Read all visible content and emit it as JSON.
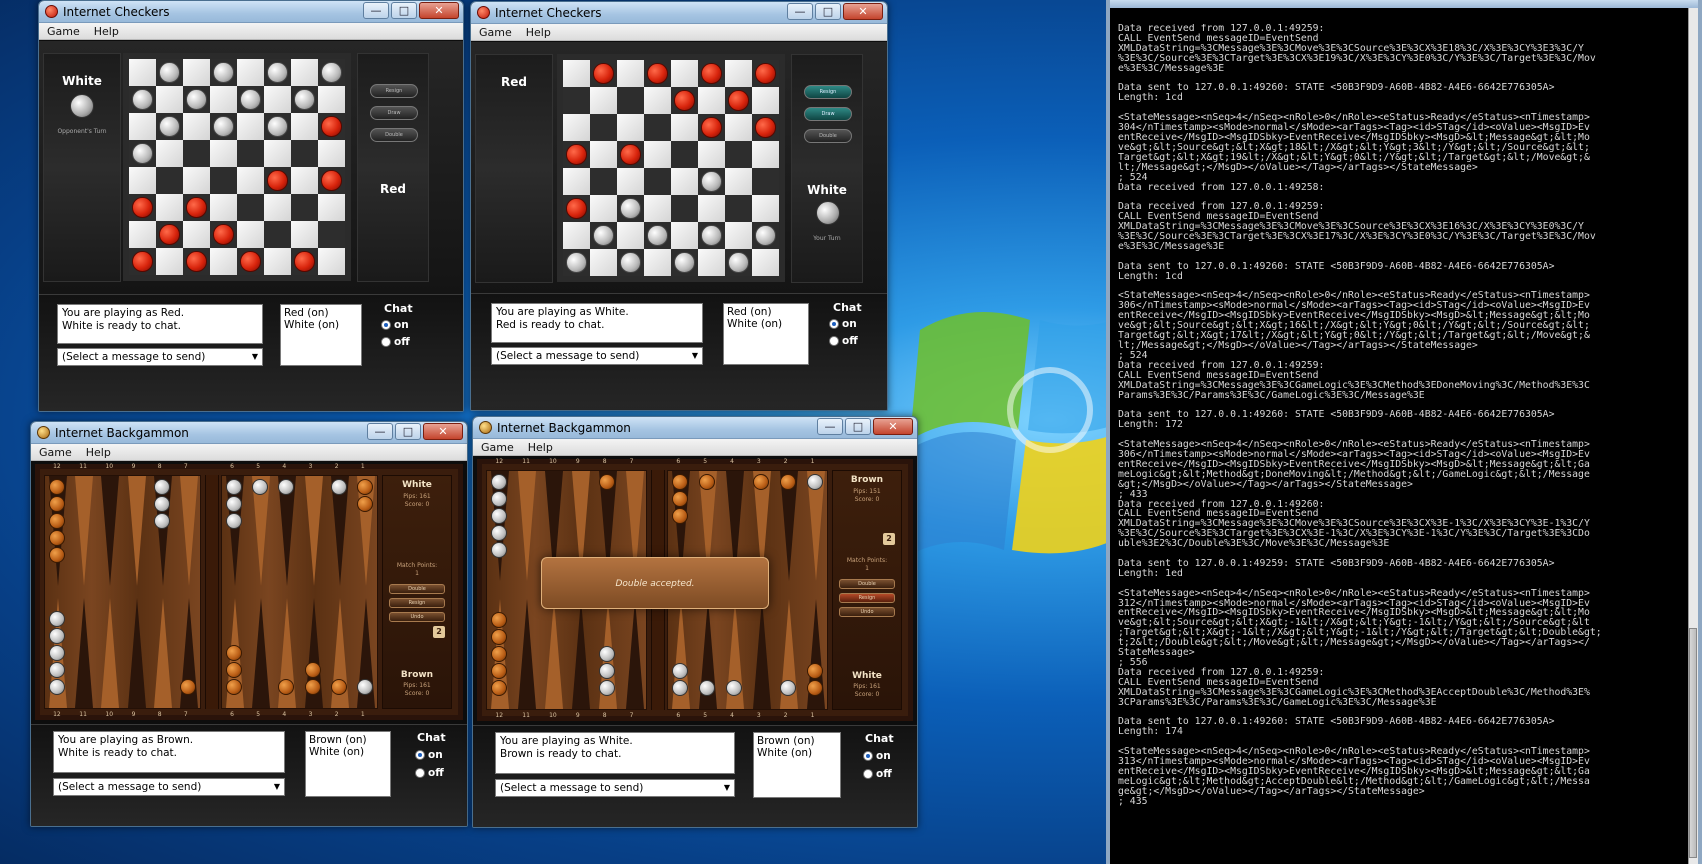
{
  "checkers1": {
    "title": "Internet Checkers",
    "menu": [
      "Game",
      "Help"
    ],
    "left_player": "White",
    "left_status": "Opponent's Turn",
    "right_player": "Red",
    "side_buttons": [
      "Resign",
      "Draw",
      "Double"
    ],
    "messages": [
      "You are playing as Red.",
      "White is ready to chat."
    ],
    "select": "(Select a message to send)",
    "players": [
      "Red (on)",
      "White (on)"
    ],
    "chat_label": "Chat",
    "radio_on": "on",
    "radio_off": "off",
    "board": [
      "-w-w-w-w",
      "w-w-w-w-",
      "-w-w-w-r",
      "w-------",
      "-----r-r",
      "r-r-----",
      "-r-r----",
      "r-r-r-r-"
    ]
  },
  "checkers2": {
    "title": "Internet Checkers",
    "menu": [
      "Game",
      "Help"
    ],
    "left_player": "Red",
    "right_player": "White",
    "right_status": "Your Turn",
    "side_buttons": [
      "Resign",
      "Draw",
      "Double"
    ],
    "messages": [
      "You are playing as White.",
      "Red is ready to chat."
    ],
    "select": "(Select a message to send)",
    "players": [
      "Red (on)",
      "White (on)"
    ],
    "chat_label": "Chat",
    "radio_on": "on",
    "radio_off": "off",
    "board": [
      "-r-r-r-r",
      "----r-r-",
      "-----r-r",
      "r-r-----",
      "-----w--",
      "r-w-----",
      "-w-w-w-w",
      "w-w-w-w-"
    ]
  },
  "backgammon1": {
    "title": "Internet Backgammon",
    "menu": [
      "Game",
      "Help"
    ],
    "top_player": "White",
    "top_pips": "Pips: 161",
    "top_score": "Score: 0",
    "match_points": "Match Points:",
    "match_value": "1",
    "buttons": [
      "Double",
      "Resign",
      "Undo"
    ],
    "cube": "2",
    "bottom_player": "Brown",
    "bottom_pips": "Pips: 161",
    "bottom_score": "Score: 0",
    "top_numbers": [
      "12",
      "11",
      "10",
      "9",
      "8",
      "7",
      "6",
      "5",
      "4",
      "3",
      "2",
      "1"
    ],
    "bottom_numbers": [
      "12",
      "11",
      "10",
      "9",
      "8",
      "7",
      "6",
      "5",
      "4",
      "3",
      "2",
      "1"
    ],
    "messages": [
      "You are playing as Brown.",
      "White is ready to chat."
    ],
    "select": "(Select a message to send)",
    "players": [
      "Brown (on)",
      "White (on)"
    ],
    "chat_label": "Chat",
    "radio_on": "on",
    "radio_off": "off"
  },
  "backgammon2": {
    "title": "Internet Backgammon",
    "menu": [
      "Game",
      "Help"
    ],
    "top_player": "Brown",
    "top_pips": "Pips: 151",
    "top_score": "Score: 0",
    "match_points": "Match Points:",
    "match_value": "1",
    "buttons": [
      "Double",
      "Resign",
      "Undo"
    ],
    "cube": "2",
    "bottom_player": "White",
    "bottom_pips": "Pips: 161",
    "bottom_score": "Score: 0",
    "top_numbers": [
      "12",
      "11",
      "10",
      "9",
      "8",
      "7",
      "6",
      "5",
      "4",
      "3",
      "2",
      "1"
    ],
    "bottom_numbers": [
      "12",
      "11",
      "10",
      "9",
      "8",
      "7",
      "6",
      "5",
      "4",
      "3",
      "2",
      "1"
    ],
    "toast": "Double accepted.",
    "messages": [
      "You are playing as White.",
      "Brown is ready to chat."
    ],
    "select": "(Select a message to send)",
    "players": [
      "Brown (on)",
      "White (on)"
    ],
    "chat_label": "Chat",
    "radio_on": "on",
    "radio_off": "off"
  },
  "console_text": "Data received from 127.0.0.1:49259:\nCALL EventSend messageID=EventSend\nXMLDataString=%3CMessage%3E%3CMove%3E%3CSource%3E%3CX%3E18%3C/X%3E%3CY%3E3%3C/Y\n%3E%3C/Source%3E%3CTarget%3E%3CX%3E19%3C/X%3E%3CY%3E0%3C/Y%3E%3C/Target%3E%3C/Mov\ne%3E%3C/Message%3E\n\nData sent to 127.0.0.1:49260: STATE <50B3F9D9-A60B-4B82-A4E6-6642E776305A>\nLength: 1cd\n\n<StateMessage><nSeq>4</nSeq><nRole>0</nRole><eStatus>Ready</eStatus><nTimestamp>\n304</nTimestamp><sMode>normal</sMode><arTags><Tag><id>STag</id><oValue><MsgID>Ev\nentReceive</MsgID><MsgIDSbky>EventReceive</MsgIDSbky><MsgD>&lt;Message&gt;&lt;Mo\nve&gt;&lt;Source&gt;&lt;X&gt;18&lt;/X&gt;&lt;Y&gt;3&lt;/Y&gt;&lt;/Source&gt;&lt;\nTarget&gt;&lt;X&gt;19&lt;/X&gt;&lt;Y&gt;0&lt;/Y&gt;&lt;/Target&gt;&lt;/Move&gt;&\nlt;/Message&gt;</MsgD></oValue></Tag></arTags></StateMessage>\n; 524\nData received from 127.0.0.1:49258:\n\nData received from 127.0.0.1:49259:\nCALL EventSend messageID=EventSend\nXMLDataString=%3CMessage%3E%3CMove%3E%3CSource%3E%3CX%3E16%3C/X%3E%3CY%3E0%3C/Y\n%3E%3C/Source%3E%3CTarget%3E%3CX%3E17%3C/X%3E%3CY%3E0%3C/Y%3E%3C/Target%3E%3C/Mov\ne%3E%3C/Message%3E\n\nData sent to 127.0.0.1:49260: STATE <50B3F9D9-A60B-4B82-A4E6-6642E776305A>\nLength: 1cd\n\n<StateMessage><nSeq>4</nSeq><nRole>0</nRole><eStatus>Ready</eStatus><nTimestamp>\n306</nTimestamp><sMode>normal</sMode><arTags><Tag><id>STag</id><oValue><MsgID>Ev\nentReceive</MsgID><MsgIDSbky>EventReceive</MsgIDSbky><MsgD>&lt;Message&gt;&lt;Mo\nve&gt;&lt;Source&gt;&lt;X&gt;16&lt;/X&gt;&lt;Y&gt;0&lt;/Y&gt;&lt;/Source&gt;&lt;\nTarget&gt;&lt;X&gt;17&lt;/X&gt;&lt;Y&gt;0&lt;/Y&gt;&lt;/Target&gt;&lt;/Move&gt;&\nlt;/Message&gt;</MsgD></oValue></Tag></arTags></StateMessage>\n; 524\nData received from 127.0.0.1:49259:\nCALL EventSend messageID=EventSend\nXMLDataString=%3CMessage%3E%3CGameLogic%3E%3CMethod%3EDoneMoving%3C/Method%3E%3C\nParams%3E%3C/Params%3E%3C/GameLogic%3E%3C/Message%3E\n\nData sent to 127.0.0.1:49260: STATE <50B3F9D9-A60B-4B82-A4E6-6642E776305A>\nLength: 172\n\n<StateMessage><nSeq>4</nSeq><nRole>0</nRole><eStatus>Ready</eStatus><nTimestamp>\n306</nTimestamp><sMode>normal</sMode><arTags><Tag><id>STag</id><oValue><MsgID>Ev\nentReceive</MsgID><MsgIDSbky>EventReceive</MsgIDSbky><MsgD>&lt;Message&gt;&lt;Ga\nmeLogic&gt;&lt;Method&gt;DoneMoving&lt;/Method&gt;&lt;/GameLogic&gt;&lt;/Message\n&gt;</MsgD></oValue></Tag></arTags></StateMessage>\n; 433\nData received from 127.0.0.1:49260:\nCALL EventSend messageID=EventSend\nXMLDataString=%3CMessage%3E%3CMove%3E%3CSource%3E%3CX%3E-1%3C/X%3E%3CY%3E-1%3C/Y\n%3E%3C/Source%3E%3CTarget%3E%3CX%3E-1%3C/X%3E%3CY%3E-1%3C/Y%3E%3C/Target%3E%3CDo\nuble%3E2%3C/Double%3E%3C/Move%3E%3C/Message%3E\n\nData sent to 127.0.0.1:49259: STATE <50B3F9D9-A60B-4B82-A4E6-6642E776305A>\nLength: 1ed\n\n<StateMessage><nSeq>4</nSeq><nRole>0</nRole><eStatus>Ready</eStatus><nTimestamp>\n312</nTimestamp><sMode>normal</sMode><arTags><Tag><id>STag</id><oValue><MsgID>Ev\nentReceive</MsgID><MsgIDSbky>EventReceive</MsgIDSbky><MsgD>&lt;Message&gt;&lt;Mo\nve&gt;&lt;Source&gt;&lt;X&gt;-1&lt;/X&gt;&lt;Y&gt;-1&lt;/Y&gt;&lt;/Source&gt;&lt\n;Target&gt;&lt;X&gt;-1&lt;/X&gt;&lt;Y&gt;-1&lt;/Y&gt;&lt;/Target&gt;&lt;Double&gt;\nt;2&lt;/Double&gt;&lt;/Move&gt;&lt;/Message&gt;</MsgD></oValue></Tag></arTags></\nStateMessage>\n; 556\nData received from 127.0.0.1:49259:\nCALL EventSend messageID=EventSend\nXMLDataString=%3CMessage%3E%3CGameLogic%3E%3CMethod%3EAcceptDouble%3C/Method%3E%\n3CParams%3E%3C/Params%3E%3C/GameLogic%3E%3C/Message%3E\n\nData sent to 127.0.0.1:49260: STATE <50B3F9D9-A60B-4B82-A4E6-6642E776305A>\nLength: 174\n\n<StateMessage><nSeq>4</nSeq><nRole>0</nRole><eStatus>Ready</eStatus><nTimestamp>\n313</nTimestamp><sMode>normal</sMode><arTags><Tag><id>STag</id><oValue><MsgID>Ev\nentReceive</MsgID><MsgIDSbky>EventReceive</MsgIDSbky><MsgD>&lt;Message&gt;&lt;Ga\nmeLogic&gt;&lt;Method&gt;AcceptDouble&lt;/Method&gt;&lt;/GameLogic&gt;&lt;/Messa\nge&gt;</MsgD></oValue></Tag></arTags></StateMessage>\n; 435"
}
